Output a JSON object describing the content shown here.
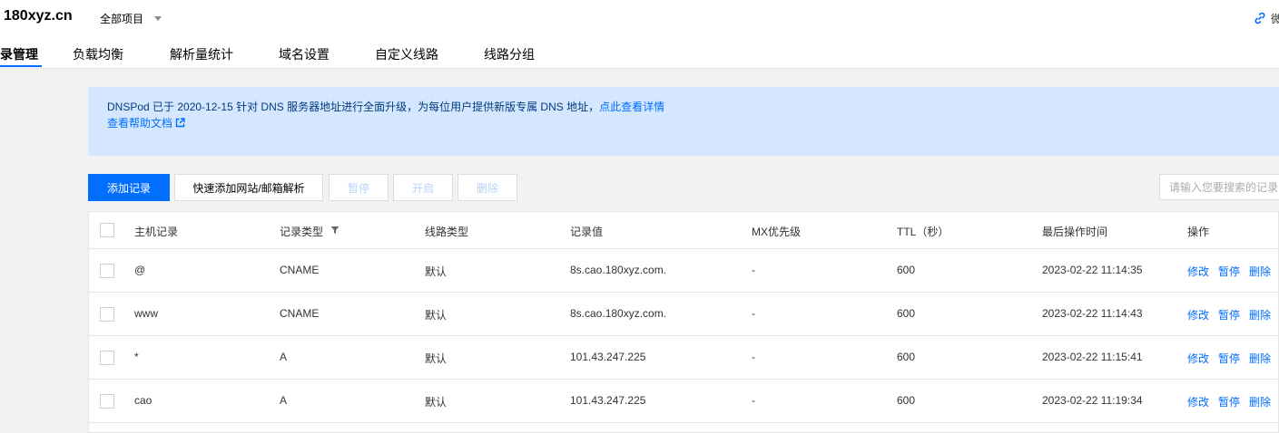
{
  "header": {
    "domain": "180xyz.cn",
    "project_select": "全部项目",
    "top_right_text": "微"
  },
  "tabs": [
    {
      "label": "记录管理",
      "visible_text": "录管理",
      "active": true
    },
    {
      "label": "负载均衡",
      "active": false
    },
    {
      "label": "解析量统计",
      "active": false
    },
    {
      "label": "域名设置",
      "active": false
    },
    {
      "label": "自定义线路",
      "active": false
    },
    {
      "label": "线路分组",
      "active": false
    }
  ],
  "notice": {
    "text": "DNSPod 已于 2020-12-15 针对 DNS 服务器地址进行全面升级，为每位用户提供新版专属 DNS 地址，",
    "link": "点此查看详情",
    "help_link": "查看帮助文档"
  },
  "toolbar": {
    "add_record": "添加记录",
    "quick_add": "快速添加网站/邮箱解析",
    "pause": "暂停",
    "enable": "开启",
    "delete": "删除",
    "search_placeholder": "请输入您要搜索的记录"
  },
  "table": {
    "columns": [
      "主机记录",
      "记录类型",
      "线路类型",
      "记录值",
      "MX优先级",
      "TTL（秒）",
      "最后操作时间",
      "操作"
    ],
    "rows": [
      {
        "host": "@",
        "type": "CNAME",
        "line": "默认",
        "value": "8s.cao.180xyz.com.",
        "mx": "-",
        "ttl": "600",
        "time": "2023-02-22 11:14:35"
      },
      {
        "host": "www",
        "type": "CNAME",
        "line": "默认",
        "value": "8s.cao.180xyz.com.",
        "mx": "-",
        "ttl": "600",
        "time": "2023-02-22 11:14:43"
      },
      {
        "host": "*",
        "type": "A",
        "line": "默认",
        "value": "101.43.247.225",
        "mx": "-",
        "ttl": "600",
        "time": "2023-02-22 11:15:41"
      },
      {
        "host": "cao",
        "type": "A",
        "line": "默认",
        "value": "101.43.247.225",
        "mx": "-",
        "ttl": "600",
        "time": "2023-02-22 11:19:34"
      }
    ],
    "actions": {
      "edit": "修改",
      "pause": "暂停",
      "delete": "删除"
    }
  },
  "colors": {
    "accent": "#006eff",
    "notice_bg": "#d5e7ff",
    "page_bg": "#f2f2f2"
  },
  "icons": [
    "caret-down-icon",
    "link-icon",
    "external-link-icon",
    "filter-icon"
  ]
}
